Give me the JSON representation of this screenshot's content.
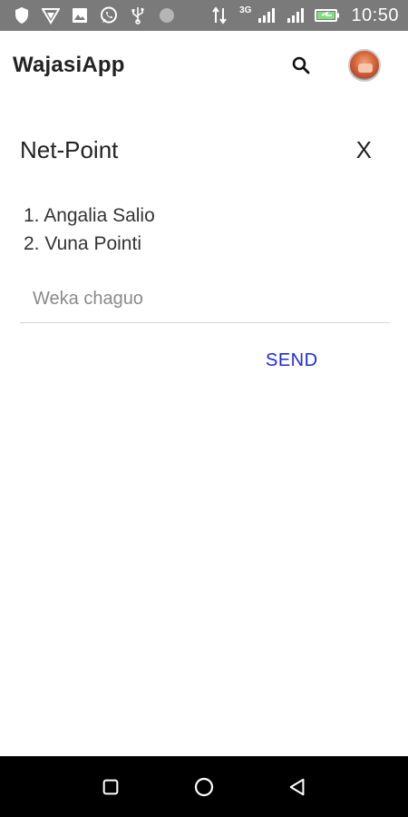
{
  "status_bar": {
    "time": "10:50",
    "network_label": "3G",
    "left_icons": [
      "shield-icon",
      "signal-wave-icon",
      "image-icon",
      "whatsapp-icon",
      "usb-icon",
      "circle-icon"
    ],
    "right_icons": [
      "data-arrows-icon",
      "cell-signal-icon",
      "cell-signal-icon",
      "battery-charging-icon"
    ]
  },
  "app_bar": {
    "title": "WajasiApp",
    "search_icon": "search-icon",
    "avatar_icon": "avatar"
  },
  "dialog": {
    "title": "Net-Point",
    "close_label": "X",
    "options": [
      "1. Angalia Salio",
      "2. Vuna Pointi"
    ],
    "input_placeholder": "Weka chaguo",
    "input_value": "",
    "send_label": "SEND"
  },
  "nav_bar": {
    "buttons": [
      "recents-square-icon",
      "home-circle-icon",
      "back-triangle-icon"
    ]
  },
  "colors": {
    "status_bar_bg": "#7a7a7a",
    "accent_send": "#1e2bd8",
    "nav_bg": "#000000"
  }
}
